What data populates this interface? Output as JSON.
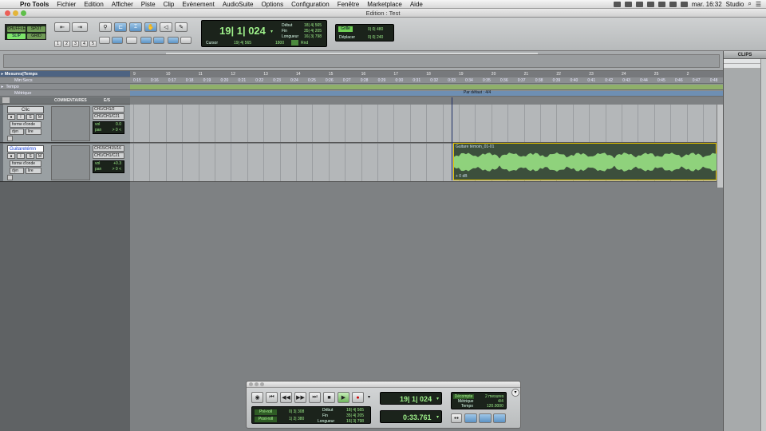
{
  "menubar": {
    "app": "Pro Tools",
    "items": [
      "Fichier",
      "Edition",
      "Afficher",
      "Piste",
      "Clip",
      "Evènement",
      "AudioSuite",
      "Options",
      "Configuration",
      "Fenêtre",
      "Marketplace",
      "Aide"
    ],
    "clock": "mar. 16:32",
    "user": "Studio"
  },
  "window": {
    "title": "Edition : Test"
  },
  "toolbar": {
    "modes": [
      "SHUFFLE",
      "SPOT",
      "SLIP",
      "GRID"
    ],
    "zoom_presets": [
      "1",
      "2",
      "3",
      "4",
      "5"
    ],
    "main_counter": "19| 1| 024",
    "cursor_label": "Cursor",
    "cursor_value": "19| 4| 565",
    "nudge_label": "1800",
    "sel_labels": [
      "Début",
      "Fin",
      "Longueur"
    ],
    "sel_values": [
      "18| 4| 565",
      "35| 4| 205",
      "16| 3| 798"
    ],
    "grid_label": "Grille",
    "grid_value": "0| 0| 480",
    "nudge2_label": "Déplacer",
    "nudge2_value": "0| 0| 240",
    "rnd": "Rnd"
  },
  "rulers": {
    "rows": [
      {
        "name": "Mesures|Temps"
      },
      {
        "name": "Min:Secs"
      },
      {
        "name": "Tempo"
      },
      {
        "name": "Métrique"
      }
    ],
    "bars": [
      "9",
      "10",
      "11",
      "12",
      "13",
      "14",
      "15",
      "16",
      "17",
      "18",
      "19",
      "20",
      "21",
      "22",
      "23",
      "24",
      "25",
      "2"
    ],
    "secs": [
      "0:15",
      "0:16",
      "0:17",
      "0:18",
      "0:19",
      "0:20",
      "0:21",
      "0:22",
      "0:23",
      "0:24",
      "0:25",
      "0:26",
      "0:27",
      "0:28",
      "0:29",
      "0:30",
      "0:31",
      "0:32",
      "0:33",
      "0:34",
      "0:35",
      "0:36",
      "0:37",
      "0:38",
      "0:39",
      "0:40",
      "0:41",
      "0:42",
      "0:43",
      "0:44",
      "0:45",
      "0:46",
      "0:47",
      "0:48"
    ],
    "meter_text": "Par défaut : 4/4"
  },
  "columns": [
    "COMMENTAIRES",
    "E/S"
  ],
  "tracks": [
    {
      "name": "Clic",
      "view": "forme d'onde",
      "dyn": "dyn",
      "lire": "lire",
      "io1": "CH1/CH1/2",
      "io2": "CH1/CH1/C21",
      "vol_label": "vol",
      "vol": "0.0",
      "pan_label": "pan",
      "pan": "> 0 <"
    },
    {
      "name": "Guitaretémn",
      "view": "forme d'onde",
      "dyn": "dyn",
      "lire": "lire",
      "io1": "CH15/CH15/16",
      "io2": "CH1/CH1/C21",
      "vol_label": "vol",
      "vol": "+0.3",
      "pan_label": "pan",
      "pan": "> 0 <"
    }
  ],
  "clip": {
    "name": "Guitare témoin_01-01",
    "gain": "+ 0 dB"
  },
  "clips_panel": {
    "title": "CLIPS"
  },
  "transport": {
    "preroll_label": "Pré-roll",
    "preroll": "0| 3| 308",
    "postroll_label": "Post-roll",
    "postroll": "1| 2| 380",
    "start_label": "Début",
    "start": "18| 4| 565",
    "end_label": "Fin",
    "end": "35| 4| 205",
    "len_label": "Longueur",
    "len": "16| 3| 798",
    "counter_bars": "19| 1| 024",
    "counter_time": "0:33.761",
    "countoff_label": "Décompte",
    "countoff": "2 mesures",
    "meter_label": "Métrique",
    "meter": "4/4",
    "tempo_label": "Tempo",
    "tempo": "120.0000"
  },
  "colors": {
    "lcd_bg": "#1b231b",
    "lcd_text": "#9ef08a",
    "clip_border": "#e2c000",
    "waveform": "#8fd27c"
  }
}
